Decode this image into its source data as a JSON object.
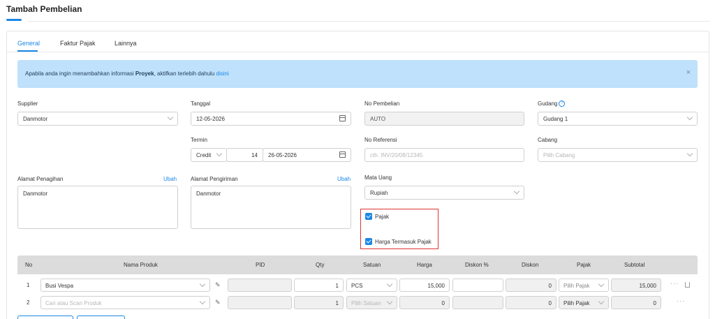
{
  "page": {
    "title": "Tambah Pembelian"
  },
  "tabs": [
    {
      "label": "General",
      "active": true
    },
    {
      "label": "Faktur Pajak",
      "active": false
    },
    {
      "label": "Lainnya",
      "active": false
    }
  ],
  "alert": {
    "text_before": "Apabila anda ingin menambahkan informasi ",
    "bold": "Proyek",
    "text_after": ", aktifkan terlebih dahulu ",
    "link": "disini",
    "close": "×"
  },
  "form": {
    "supplier": {
      "label": "Supplier",
      "value": "Danmotor"
    },
    "tanggal": {
      "label": "Tanggal",
      "value": "12-05-2026"
    },
    "no_pembelian": {
      "label": "No Pembelian",
      "value": "AUTO"
    },
    "gudang": {
      "label": "Gudang",
      "help": "?",
      "value": "Gudang 1"
    },
    "termin": {
      "label": "Termin",
      "type": "Credit",
      "days": "14",
      "date": "26-05-2026"
    },
    "no_referensi": {
      "label": "No Referensi",
      "placeholder": "cth. INV/20/08/12345"
    },
    "cabang": {
      "label": "Cabang",
      "placeholder": "Pilih Cabang"
    },
    "alamat_penagihan": {
      "label": "Alamat Penagihan",
      "action": "Ubah",
      "value": "Danmotor"
    },
    "alamat_pengiriman": {
      "label": "Alamat Pengiriman",
      "action": "Ubah",
      "value": "Danmotor"
    },
    "mata_uang": {
      "label": "Mata Uang",
      "value": "Rupiah"
    },
    "pajak": {
      "label": "Pajak",
      "checked": true
    },
    "harga_termasuk_pajak": {
      "label": "Harga Termasuk Pajak",
      "checked": true
    }
  },
  "table": {
    "headers": {
      "no": "No",
      "nama_produk": "Nama Produk",
      "pid": "PID",
      "qty": "Qty",
      "satuan": "Satuan",
      "harga": "Harga",
      "diskon_pct": "Diskon %",
      "diskon": "Diskon",
      "pajak": "Pajak",
      "subtotal": "Subtotal"
    },
    "rows": [
      {
        "no": "1",
        "produk": "Busi Vespa",
        "pid": "",
        "qty": "1",
        "satuan": "PCS",
        "harga": "15,000",
        "diskon_pct": "",
        "diskon": "0",
        "pajak": "Pilih Pajak",
        "subtotal": "15,000",
        "actions": "···"
      },
      {
        "no": "2",
        "produk_placeholder": "Cari atau Scan Produk",
        "pid": "",
        "qty": "1",
        "satuan_placeholder": "Pilih Satuan",
        "harga": "0",
        "diskon_pct": "",
        "diskon": "0",
        "pajak": "Pilih Pajak",
        "subtotal": "0",
        "actions": "···"
      }
    ]
  },
  "colors": {
    "accent": "#1b87e6",
    "alert_bg": "#bfe1fb",
    "highlight_border": "#dd3333",
    "table_header": "#dcdcdc"
  },
  "icons": [
    "calendar-icon",
    "chevron-down-icon",
    "help-icon",
    "close-icon",
    "pencil-icon",
    "more-icon",
    "trash-icon",
    "checkbox-icon"
  ]
}
